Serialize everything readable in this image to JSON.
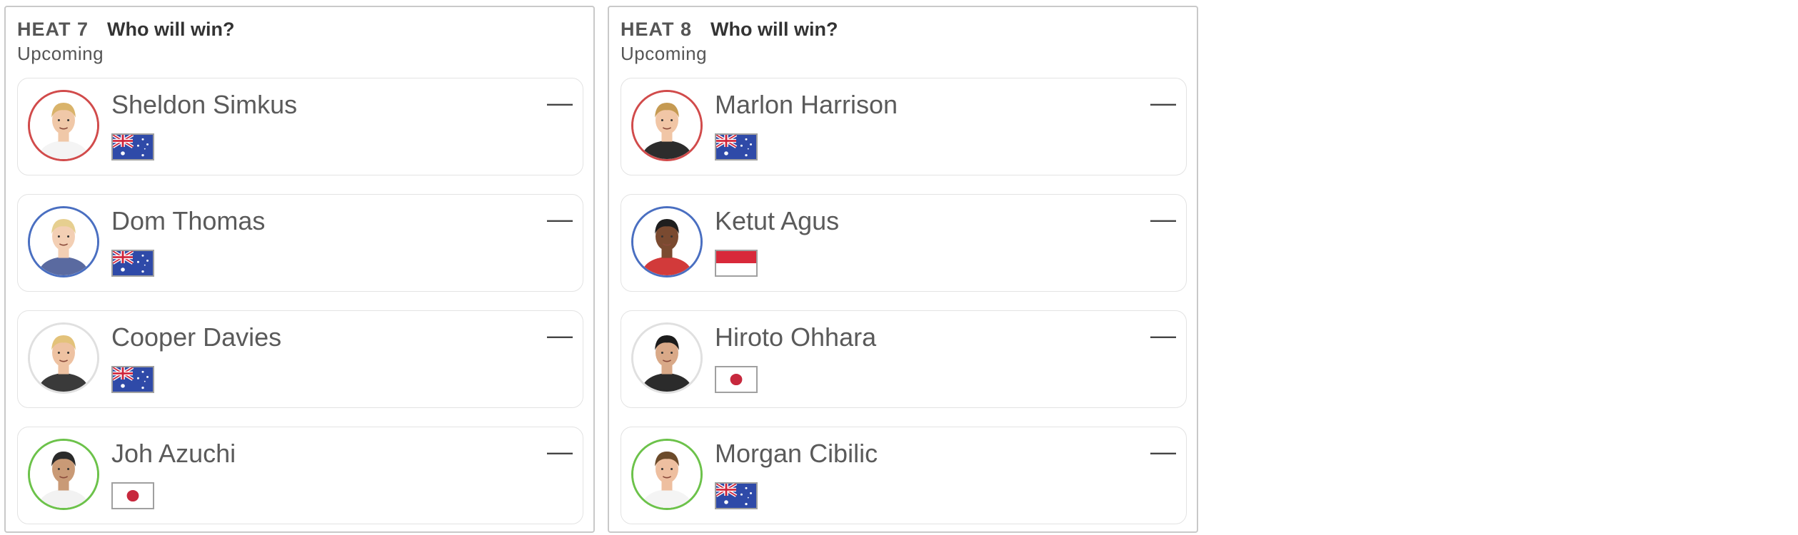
{
  "heats": [
    {
      "label": "HEAT 7",
      "question": "Who will win?",
      "status": "Upcoming",
      "surfers": [
        {
          "name": "Sheldon Simkus",
          "country": "australia",
          "ring_color": "#d14b4b",
          "score": "—"
        },
        {
          "name": "Dom Thomas",
          "country": "australia",
          "ring_color": "#4a6fc1",
          "score": "—"
        },
        {
          "name": "Cooper Davies",
          "country": "australia",
          "ring_color": "#e0e0e0",
          "score": "—"
        },
        {
          "name": "Joh Azuchi",
          "country": "japan",
          "ring_color": "#6cc24a",
          "score": "—"
        }
      ]
    },
    {
      "label": "HEAT 8",
      "question": "Who will win?",
      "status": "Upcoming",
      "surfers": [
        {
          "name": "Marlon Harrison",
          "country": "australia",
          "ring_color": "#d14b4b",
          "score": "—"
        },
        {
          "name": "Ketut Agus",
          "country": "indonesia",
          "ring_color": "#4a6fc1",
          "score": "—"
        },
        {
          "name": "Hiroto Ohhara",
          "country": "japan",
          "ring_color": "#e0e0e0",
          "score": "—"
        },
        {
          "name": "Morgan Cibilic",
          "country": "australia",
          "ring_color": "#6cc24a",
          "score": "—"
        }
      ]
    }
  ],
  "icons": {
    "australia": "australia-flag-icon",
    "japan": "japan-flag-icon",
    "indonesia": "indonesia-flag-icon",
    "avatar": "surfer-avatar"
  }
}
